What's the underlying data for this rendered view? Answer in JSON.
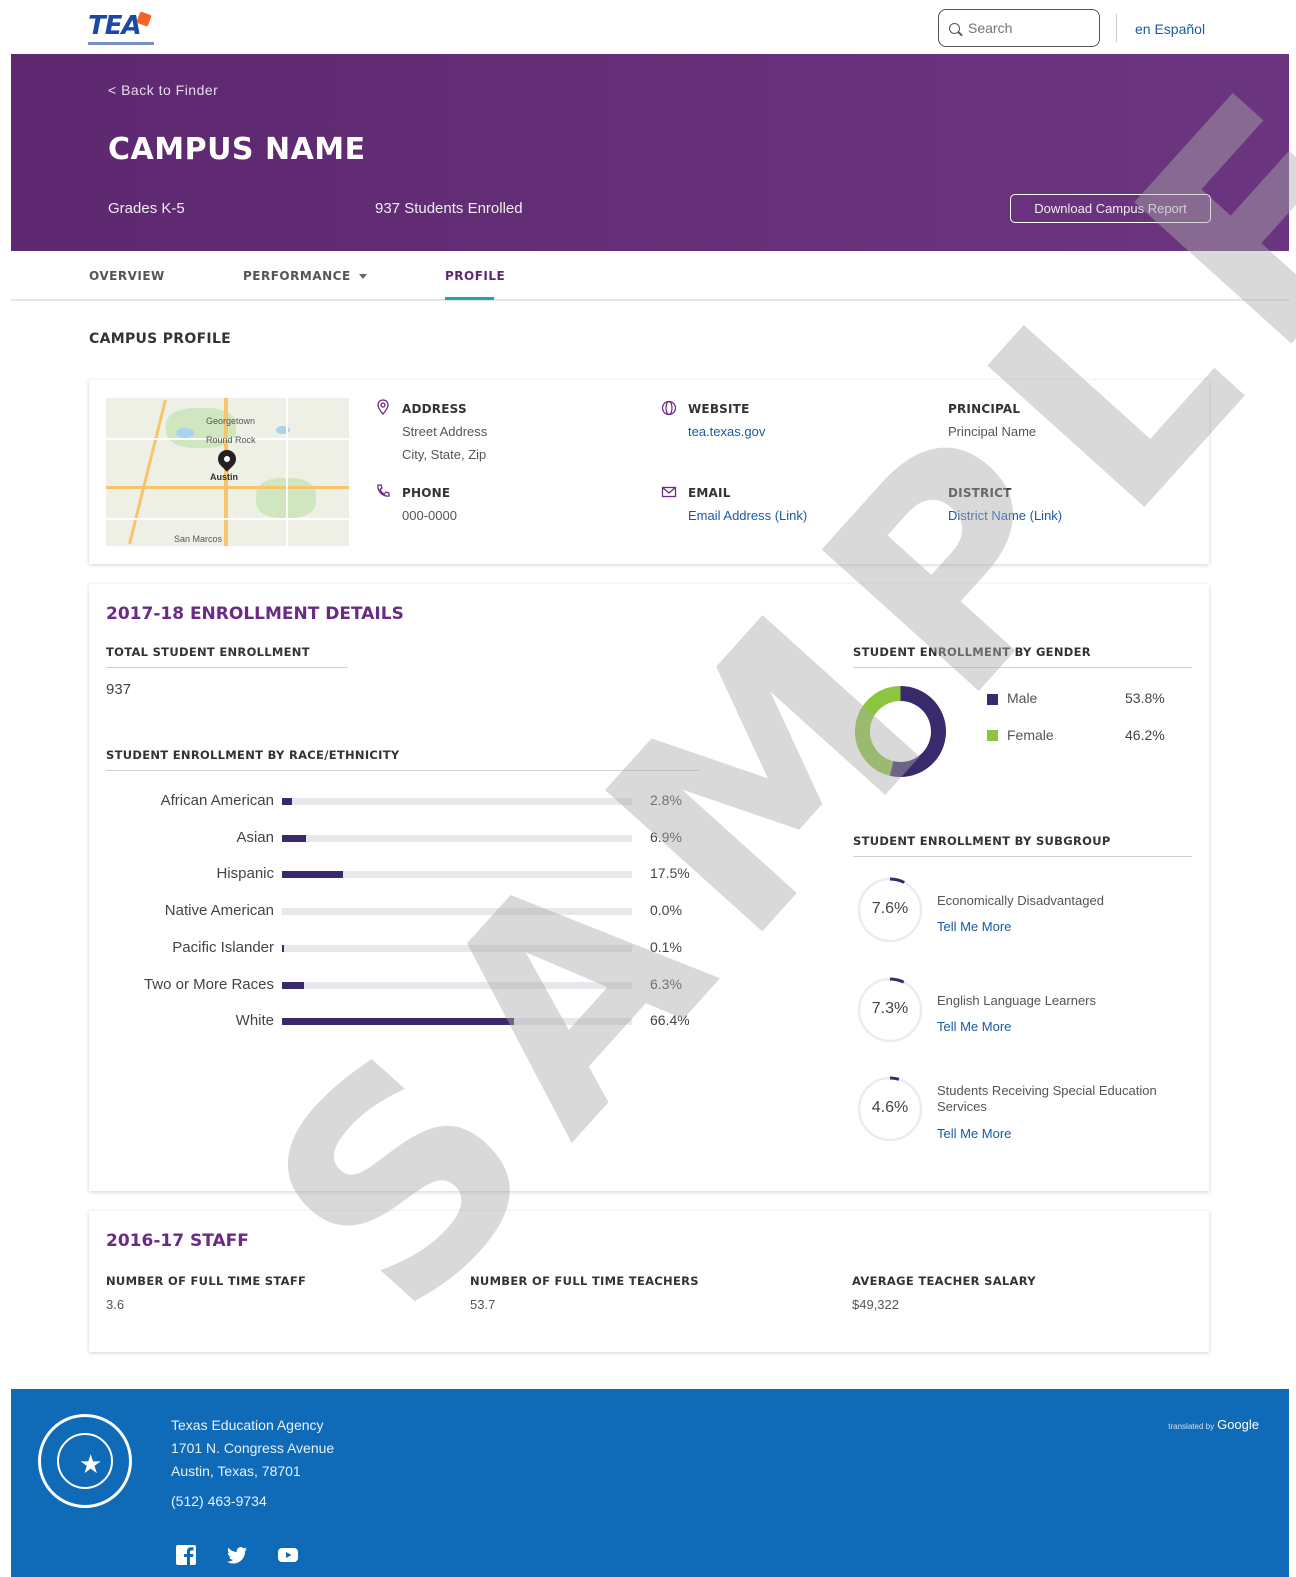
{
  "header": {
    "logo_text": "TEA",
    "search_placeholder": "Search",
    "language_link": "en Español"
  },
  "hero": {
    "back_link": "< Back to Finder",
    "campus_name": "CAMPUS NAME",
    "grades": "Grades K-5",
    "students_enrolled": "937 Students Enrolled",
    "download_button": "Download Campus Report"
  },
  "tabs": [
    {
      "label": "OVERVIEW"
    },
    {
      "label": "PERFORMANCE"
    },
    {
      "label": "PROFILE"
    }
  ],
  "section_heading": "CAMPUS PROFILE",
  "profile": {
    "map_labels": [
      "Georgetown",
      "Round Rock",
      "Austin",
      "San Marcos"
    ],
    "address_label": "ADDRESS",
    "address_line1": "Street Address",
    "address_line2": "City, State, Zip",
    "phone_label": "PHONE",
    "phone_value": "000-0000",
    "website_label": "WEBSITE",
    "website_link": "tea.texas.gov",
    "email_label": "EMAIL",
    "email_link": "Email Address (Link)",
    "principal_label": "PRINCIPAL",
    "principal_value": "Principal Name",
    "district_label": "DISTRICT",
    "district_link": "District Name (Link)"
  },
  "enrollment": {
    "title": "2017-18 ENROLLMENT DETAILS",
    "total_label": "TOTAL STUDENT ENROLLMENT",
    "total_value": "937",
    "race_label": "STUDENT ENROLLMENT BY RACE/ETHNICITY",
    "race": [
      {
        "name": "African American",
        "pct_text": "2.8%",
        "pct": 2.8
      },
      {
        "name": "Asian",
        "pct_text": "6.9%",
        "pct": 6.9
      },
      {
        "name": "Hispanic",
        "pct_text": "17.5%",
        "pct": 17.5
      },
      {
        "name": "Native American",
        "pct_text": "0.0%",
        "pct": 0.0
      },
      {
        "name": "Pacific Islander",
        "pct_text": "0.1%",
        "pct": 0.1
      },
      {
        "name": "Two or More Races",
        "pct_text": "6.3%",
        "pct": 6.3
      },
      {
        "name": "White",
        "pct_text": "66.4%",
        "pct": 66.4
      }
    ],
    "gender_label": "STUDENT ENROLLMENT BY GENDER",
    "gender": [
      {
        "name": "Male",
        "pct_text": "53.8%",
        "pct": 53.8,
        "color": "#3b2a6b"
      },
      {
        "name": "Female",
        "pct_text": "46.2%",
        "pct": 46.2,
        "color": "#8cc63f"
      }
    ],
    "subgroup_label": "STUDENT ENROLLMENT BY SUBGROUP",
    "subgroups": [
      {
        "pct_text": "7.6%",
        "pct": 7.6,
        "name": "Economically Disadvantaged",
        "link": "Tell Me More"
      },
      {
        "pct_text": "7.3%",
        "pct": 7.3,
        "name": "English Language Learners",
        "link": "Tell Me More"
      },
      {
        "pct_text": "4.6%",
        "pct": 4.6,
        "name": "Students Receiving Special Education Services",
        "link": "Tell Me More"
      }
    ]
  },
  "staff": {
    "title": "2016-17 STAFF",
    "full_time_staff_label": "NUMBER OF FULL TIME STAFF",
    "full_time_staff_value": "3.6",
    "full_time_teachers_label": "NUMBER OF FULL TIME TEACHERS",
    "full_time_teachers_value": "53.7",
    "salary_label": "AVERAGE TEACHER SALARY",
    "salary_value": "$49,322"
  },
  "watermark": "SAMPLE",
  "footer": {
    "org": "Texas Education Agency",
    "street": "1701 N. Congress Avenue",
    "city": "Austin, Texas, 78701",
    "phone": "(512) 463-9734",
    "translated_by": "translated by",
    "google": "Google"
  },
  "colors": {
    "brand_purple": "#5e2870",
    "title_purple": "#6b2a86",
    "bar_navy": "#3b2a6b",
    "female_green": "#8cc63f",
    "tab_accent": "#1aa8b6",
    "footer_blue": "#0f6ab8",
    "link_blue": "#1a5aa6"
  }
}
